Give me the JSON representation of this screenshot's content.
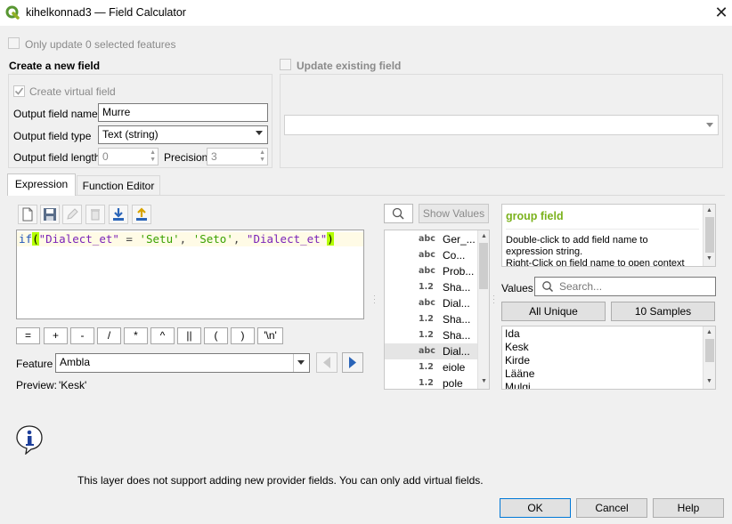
{
  "window": {
    "title": "kihelkonnad3 — Field Calculator",
    "close": "✕"
  },
  "only_update_selected": "Only update 0 selected features",
  "new_field": {
    "heading": "Create a new field",
    "virtual_label": "Create virtual field",
    "output_name_label": "Output field name",
    "output_name_value": "Murre",
    "output_type_label": "Output field type",
    "output_type_value": "Text (string)",
    "output_length_label": "Output field length",
    "output_length_value": "0",
    "precision_label": "Precision",
    "precision_value": "3"
  },
  "update_existing": {
    "label": "Update existing field"
  },
  "tabs": [
    {
      "label": "Expression"
    },
    {
      "label": "Function Editor"
    }
  ],
  "expression": {
    "fn": "if",
    "paren_open": "(",
    "arg1": "\"Dialect_et\"",
    "op": " = ",
    "arg2": "'Setu'",
    "sep1": ", ",
    "arg3": "'Seto'",
    "sep2": ", ",
    "arg4": "\"Dialect_et\"",
    "paren_close": ")"
  },
  "operators": [
    "=",
    "+",
    "-",
    "/",
    "*",
    "^",
    "||",
    "(",
    ")",
    "'\\n'"
  ],
  "feature": {
    "label": "Feature",
    "value": "Ambla"
  },
  "preview": {
    "label": "Preview:",
    "value": "'Kesk'"
  },
  "show_values": "Show Values",
  "fields": [
    {
      "type": "abc",
      "name": "Ger_..."
    },
    {
      "type": "abc",
      "name": "Co..."
    },
    {
      "type": "abc",
      "name": "Prob..."
    },
    {
      "type": "1.2",
      "name": "Sha..."
    },
    {
      "type": "abc",
      "name": "Dial..."
    },
    {
      "type": "1.2",
      "name": "Sha..."
    },
    {
      "type": "1.2",
      "name": "Sha..."
    },
    {
      "type": "abc",
      "name": "Dial..."
    },
    {
      "type": "1.2",
      "name": "eiole"
    },
    {
      "type": "1.2",
      "name": "pole"
    }
  ],
  "help": {
    "title": "group field",
    "line1": "Double-click to add field name to",
    "line2": "expression string.",
    "line3": "Right-Click on field name to open context"
  },
  "values": {
    "label": "Values",
    "search_placeholder": "Search...",
    "all_unique": "All Unique",
    "ten_samples": "10 Samples",
    "items": [
      "Ida",
      "Kesk",
      "Kirde",
      "Lääne",
      "Mulgi"
    ]
  },
  "message": "This layer does not support adding new provider fields. You can only add virtual fields.",
  "buttons": {
    "ok": "OK",
    "cancel": "Cancel",
    "help": "Help"
  },
  "colors": {
    "accent": "#0078d7",
    "help_title": "#7bb21d",
    "paren_highlight": "#b4ff00",
    "expr_fn": "#1f54b8",
    "expr_field": "#7a22b8",
    "expr_string": "#3aa200"
  }
}
